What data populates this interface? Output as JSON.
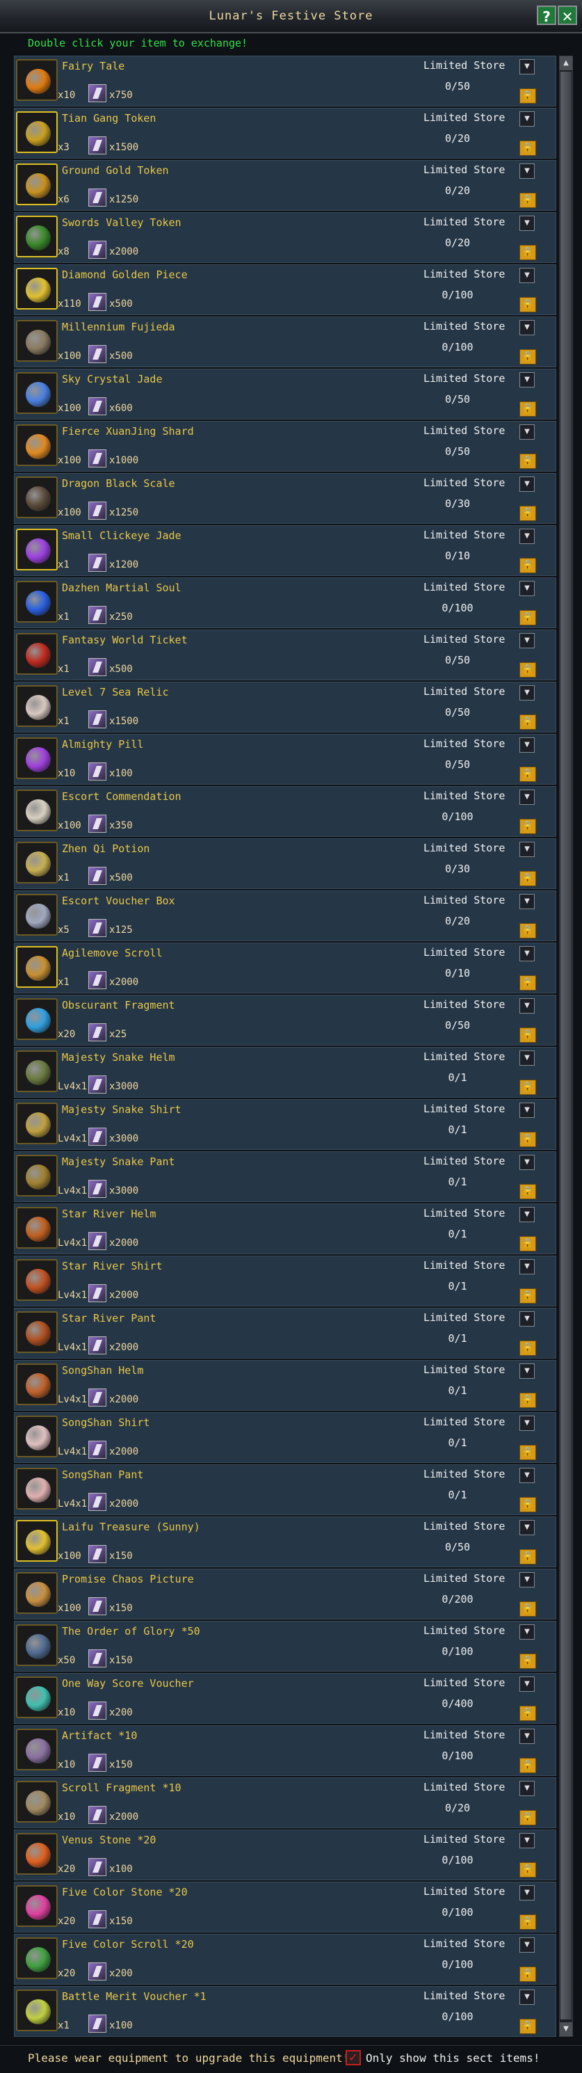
{
  "window": {
    "title": "Lunar's Festive Store",
    "help_label": "?",
    "close_label": "✕"
  },
  "hint": "Double click your item to exchange!",
  "currency_icon": "bunny-token-icon",
  "items": [
    {
      "name": "Fairy Tale",
      "qty": "x10",
      "price": "x750",
      "store": "Limited Store",
      "count": "0/50",
      "color": "#e07a10"
    },
    {
      "name": "Tian Gang Token",
      "qty": "x3",
      "price": "x1500",
      "store": "Limited Store",
      "count": "0/20",
      "color": "#c8a020"
    },
    {
      "name": "Ground Gold Token",
      "qty": "x6",
      "price": "x1250",
      "store": "Limited Store",
      "count": "0/20",
      "color": "#c89020"
    },
    {
      "name": "Swords Valley Token",
      "qty": "x8",
      "price": "x2000",
      "store": "Limited Store",
      "count": "0/20",
      "color": "#3a8a2a"
    },
    {
      "name": "Diamond Golden Piece",
      "qty": "x110",
      "price": "x500",
      "store": "Limited Store",
      "count": "0/100",
      "color": "#e0c030"
    },
    {
      "name": "Millennium Fujieda",
      "qty": "x100",
      "price": "x500",
      "store": "Limited Store",
      "count": "0/100",
      "color": "#8a7a60"
    },
    {
      "name": "Sky Crystal Jade",
      "qty": "x100",
      "price": "x600",
      "store": "Limited Store",
      "count": "0/50",
      "color": "#4a80e0"
    },
    {
      "name": "Fierce XuanJing Shard",
      "qty": "x100",
      "price": "x1000",
      "store": "Limited Store",
      "count": "0/50",
      "color": "#e08a20"
    },
    {
      "name": "Dragon Black Scale",
      "qty": "x100",
      "price": "x1250",
      "store": "Limited Store",
      "count": "0/30",
      "color": "#5a4a3a"
    },
    {
      "name": "Small Clickeye Jade",
      "qty": "x1",
      "price": "x1200",
      "store": "Limited Store",
      "count": "0/10",
      "color": "#9a40e0"
    },
    {
      "name": "Dazhen Martial Soul",
      "qty": "x1",
      "price": "x250",
      "store": "Limited Store",
      "count": "0/100",
      "color": "#2a60e0"
    },
    {
      "name": "Fantasy World Ticket",
      "qty": "x1",
      "price": "x500",
      "store": "Limited Store",
      "count": "0/50",
      "color": "#c02a20"
    },
    {
      "name": "Level 7 Sea Relic",
      "qty": "x1",
      "price": "x1500",
      "store": "Limited Store",
      "count": "0/50",
      "color": "#d8c8c0"
    },
    {
      "name": "Almighty Pill",
      "qty": "x10",
      "price": "x100",
      "store": "Limited Store",
      "count": "0/50",
      "color": "#a040e0"
    },
    {
      "name": "Escort Commendation",
      "qty": "x100",
      "price": "x350",
      "store": "Limited Store",
      "count": "0/100",
      "color": "#d8d0c0"
    },
    {
      "name": "Zhen Qi Potion",
      "qty": "x1",
      "price": "x500",
      "store": "Limited Store",
      "count": "0/30",
      "color": "#c8b050"
    },
    {
      "name": "Escort Voucher Box",
      "qty": "x5",
      "price": "x125",
      "store": "Limited Store",
      "count": "0/20",
      "color": "#a0a8c0"
    },
    {
      "name": "Agilemove Scroll",
      "qty": "x1",
      "price": "x2000",
      "store": "Limited Store",
      "count": "0/10",
      "color": "#c89030"
    },
    {
      "name": "Obscurant Fragment",
      "qty": "x20",
      "price": "x25",
      "store": "Limited Store",
      "count": "0/50",
      "color": "#30a0e0"
    },
    {
      "name": "Majesty Snake Helm",
      "qty": "Lv4x1",
      "price": "x3000",
      "store": "Limited Store",
      "count": "0/1",
      "color": "#6a7a40"
    },
    {
      "name": "Majesty Snake Shirt",
      "qty": "Lv4x1",
      "price": "x3000",
      "store": "Limited Store",
      "count": "0/1",
      "color": "#c0a040"
    },
    {
      "name": "Majesty Snake Pant",
      "qty": "Lv4x1",
      "price": "x3000",
      "store": "Limited Store",
      "count": "0/1",
      "color": "#a08030"
    },
    {
      "name": "Star River Helm",
      "qty": "Lv4x1",
      "price": "x2000",
      "store": "Limited Store",
      "count": "0/1",
      "color": "#c06020"
    },
    {
      "name": "Star River Shirt",
      "qty": "Lv4x1",
      "price": "x2000",
      "store": "Limited Store",
      "count": "0/1",
      "color": "#c05020"
    },
    {
      "name": "Star River Pant",
      "qty": "Lv4x1",
      "price": "x2000",
      "store": "Limited Store",
      "count": "0/1",
      "color": "#b05020"
    },
    {
      "name": "SongShan Helm",
      "qty": "Lv4x1",
      "price": "x2000",
      "store": "Limited Store",
      "count": "0/1",
      "color": "#c0602a"
    },
    {
      "name": "SongShan Shirt",
      "qty": "Lv4x1",
      "price": "x2000",
      "store": "Limited Store",
      "count": "0/1",
      "color": "#e0c0c0"
    },
    {
      "name": "SongShan Pant",
      "qty": "Lv4x1",
      "price": "x2000",
      "store": "Limited Store",
      "count": "0/1",
      "color": "#e0b0b0"
    },
    {
      "name": "Laifu Treasure (Sunny)",
      "qty": "x100",
      "price": "x150",
      "store": "Limited Store",
      "count": "0/50",
      "color": "#e0c030"
    },
    {
      "name": "Promise Chaos Picture",
      "qty": "x100",
      "price": "x150",
      "store": "Limited Store",
      "count": "0/200",
      "color": "#c89040"
    },
    {
      "name": "The Order of Glory *50",
      "qty": "x50",
      "price": "x150",
      "store": "Limited Store",
      "count": "0/100",
      "color": "#506a90"
    },
    {
      "name": "One Way Score Voucher",
      "qty": "x10",
      "price": "x200",
      "store": "Limited Store",
      "count": "0/400",
      "color": "#40c0b0"
    },
    {
      "name": "Artifact *10",
      "qty": "x10",
      "price": "x150",
      "store": "Limited Store",
      "count": "0/100",
      "color": "#8a70a0"
    },
    {
      "name": "Scroll Fragment *10",
      "qty": "x10",
      "price": "x2000",
      "store": "Limited Store",
      "count": "0/20",
      "color": "#a08a60"
    },
    {
      "name": "Venus Stone *20",
      "qty": "x20",
      "price": "x100",
      "store": "Limited Store",
      "count": "0/100",
      "color": "#e06020"
    },
    {
      "name": "Five Color Stone *20",
      "qty": "x20",
      "price": "x150",
      "store": "Limited Store",
      "count": "0/100",
      "color": "#e040a0"
    },
    {
      "name": "Five Color Scroll *20",
      "qty": "x20",
      "price": "x200",
      "store": "Limited Store",
      "count": "0/100",
      "color": "#40a040"
    },
    {
      "name": "Battle Merit Voucher *1",
      "qty": "x1",
      "price": "x100",
      "store": "Limited Store",
      "count": "0/100",
      "color": "#c0d040"
    }
  ],
  "footer": {
    "warning": "Please wear equipment to upgrade this equipment!",
    "checkbox_label": "Only show this sect items!",
    "checkbox_checked": true
  }
}
